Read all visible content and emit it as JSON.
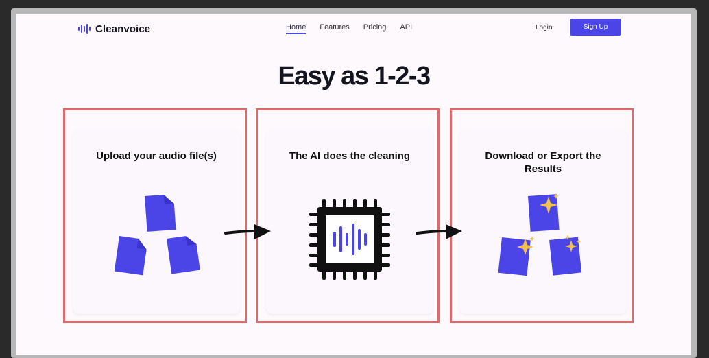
{
  "nav": {
    "brand": "Cleanvoice",
    "links": [
      {
        "label": "Home",
        "active": true
      },
      {
        "label": "Features"
      },
      {
        "label": "Pricing"
      },
      {
        "label": "API"
      }
    ],
    "login": "Login",
    "signup": "Sign Up"
  },
  "headline": "Easy as 1-2-3",
  "steps": [
    {
      "title": "Upload your audio file(s)",
      "icon": "audio-files-icon"
    },
    {
      "title": "The AI does the cleaning",
      "icon": "ai-chip-icon"
    },
    {
      "title": "Download or Export the Results",
      "icon": "sparkling-files-icon"
    }
  ],
  "colors": {
    "accent": "#4b44e6",
    "highlight_border": "#dd6b6b",
    "sparkle": "#f2c14e",
    "page_bg": "#fdf9fd"
  }
}
